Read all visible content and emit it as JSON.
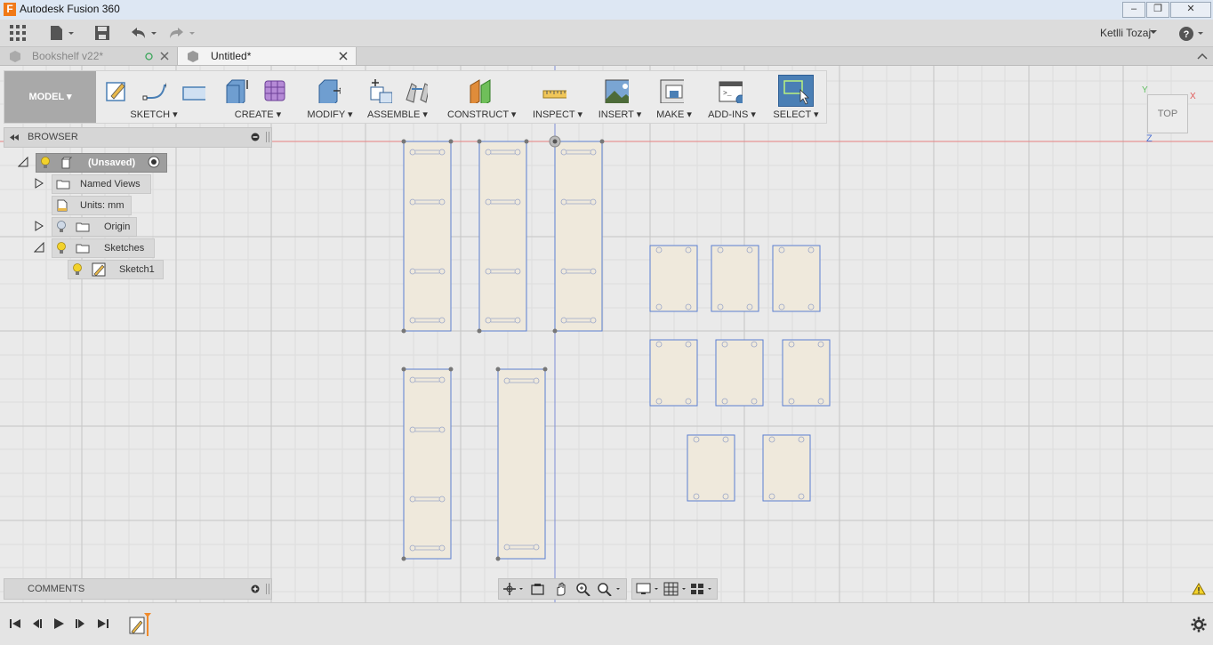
{
  "window": {
    "title": "Autodesk Fusion 360",
    "logo_letter": "F",
    "minimize": "–",
    "restore": "❐",
    "close": "✕"
  },
  "appbar": {
    "user": "Ketlli Tozaj"
  },
  "tabs": [
    {
      "label": "Bookshelf v22*"
    },
    {
      "label": "Untitled*"
    }
  ],
  "toolbar": {
    "workspace": "MODEL",
    "groups": [
      "SKETCH",
      "CREATE",
      "MODIFY",
      "ASSEMBLE",
      "CONSTRUCT",
      "INSPECT",
      "INSERT",
      "MAKE",
      "ADD-INS",
      "SELECT"
    ]
  },
  "browser": {
    "title": "BROWSER",
    "root": "(Unsaved)",
    "items": [
      "Named Views",
      "Units: mm",
      "Origin",
      "Sketches",
      "Sketch1"
    ]
  },
  "comments": {
    "title": "COMMENTS"
  },
  "viewcube": {
    "face": "TOP",
    "axis_x": "X",
    "axis_y": "Y",
    "axis_z": "Z"
  },
  "colors": {
    "accent": "#4a7fb5",
    "sketch_line": "#5b7fd1",
    "panel_fill": "#efe9dc",
    "red_axis": "#e58080"
  }
}
